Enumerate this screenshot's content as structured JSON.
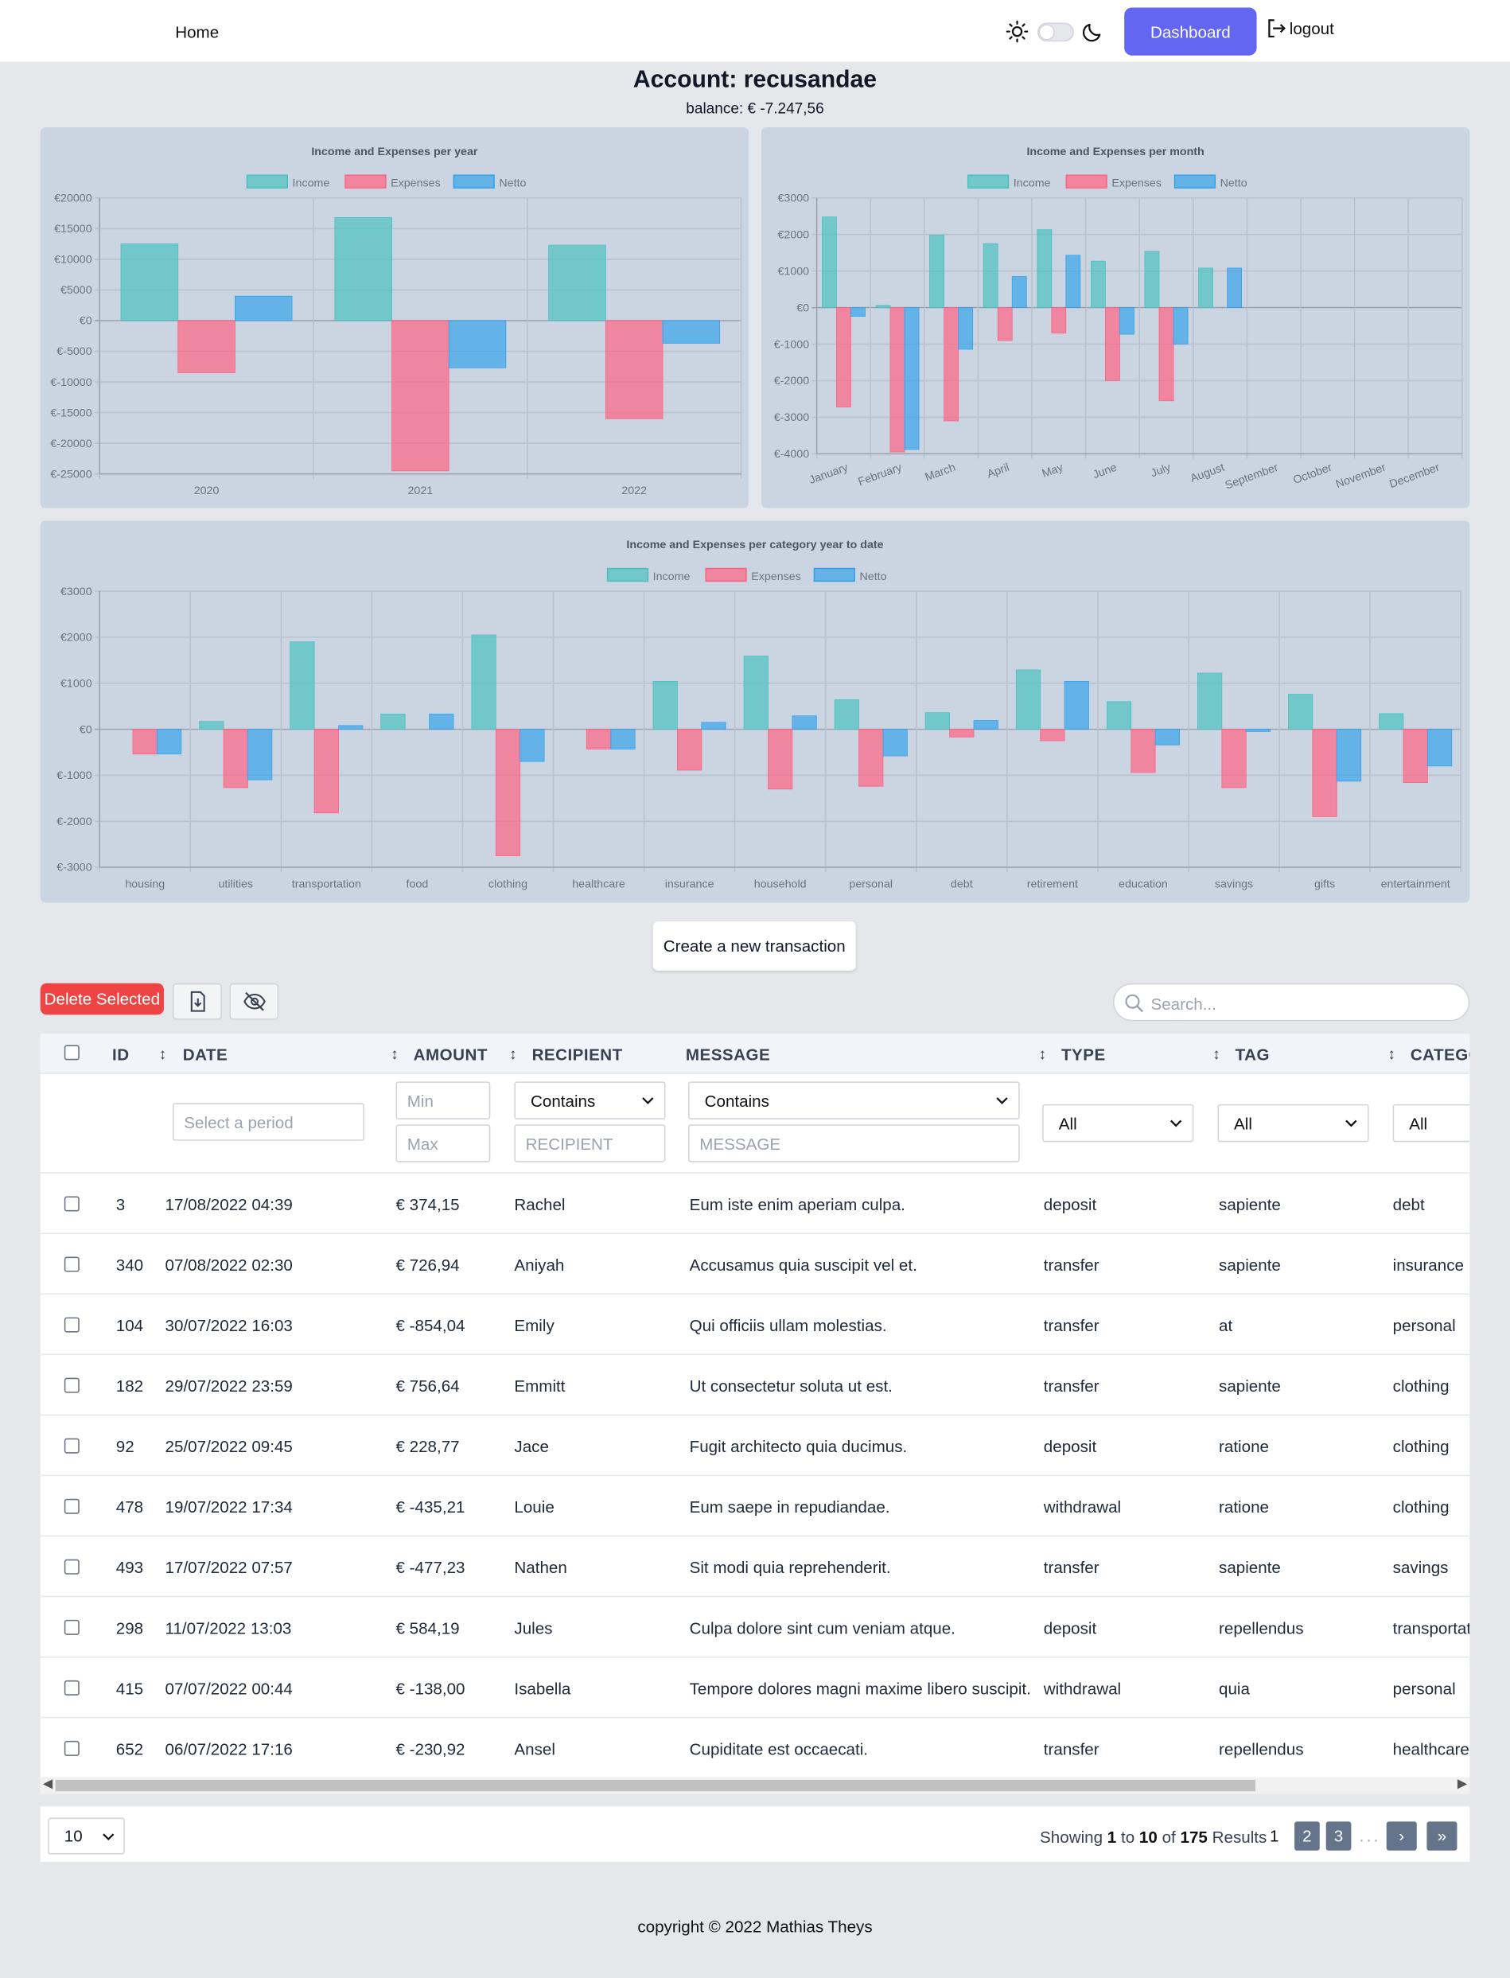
{
  "nav": {
    "home": "Home",
    "dashboard": "Dashboard",
    "logout": "logout"
  },
  "account": {
    "title": "Account: recusandae",
    "balance": "balance: € -7.247,56"
  },
  "colors": {
    "income": "#4bc0c0",
    "expenses": "#ff6384",
    "netto": "#36a2eb",
    "accent": "#6366f1",
    "delete": "#ef4444"
  },
  "legend": [
    "Income",
    "Expenses",
    "Netto"
  ],
  "chart_data": [
    {
      "type": "bar",
      "title": "Income and Expenses per year",
      "categories": [
        "2020",
        "2021",
        "2022"
      ],
      "series": [
        {
          "name": "Income",
          "values": [
            12500,
            16800,
            12300
          ]
        },
        {
          "name": "Expenses",
          "values": [
            -8500,
            -24500,
            -16000
          ]
        },
        {
          "name": "Netto",
          "values": [
            4000,
            -7700,
            -3700
          ]
        }
      ],
      "ylim": [
        -25000,
        20000
      ],
      "yticks": [
        "€20000",
        "€15000",
        "€10000",
        "€5000",
        "€0",
        "€-5000",
        "€-10000",
        "€-15000",
        "€-20000",
        "€-25000"
      ],
      "grid": true,
      "legend": "top"
    },
    {
      "type": "bar",
      "title": "Income and Expenses per month",
      "categories": [
        "January",
        "February",
        "March",
        "April",
        "May",
        "June",
        "July",
        "August",
        "September",
        "October",
        "November",
        "December"
      ],
      "series": [
        {
          "name": "Income",
          "values": [
            2480,
            60,
            1980,
            1750,
            2130,
            1270,
            1540,
            1080,
            0,
            0,
            0,
            0
          ]
        },
        {
          "name": "Expenses",
          "values": [
            -2720,
            -3950,
            -3100,
            -900,
            -700,
            -2000,
            -2550,
            0,
            0,
            0,
            0,
            0
          ]
        },
        {
          "name": "Netto",
          "values": [
            -240,
            -3880,
            -1140,
            850,
            1430,
            -730,
            -1000,
            1080,
            0,
            0,
            0,
            0
          ]
        }
      ],
      "ylim": [
        -4000,
        3000
      ],
      "yticks": [
        "€3000",
        "€2000",
        "€1000",
        "€0",
        "€-1000",
        "€-2000",
        "€-3000",
        "€-4000"
      ],
      "grid": true,
      "legend": "top"
    },
    {
      "type": "bar",
      "title": "Income and Expenses per category year to date",
      "categories": [
        "housing",
        "utilities",
        "transportation",
        "food",
        "clothing",
        "healthcare",
        "insurance",
        "household",
        "personal",
        "debt",
        "retirement",
        "education",
        "savings",
        "gifts",
        "entertainment"
      ],
      "series": [
        {
          "name": "Income",
          "values": [
            0,
            170,
            1900,
            330,
            2050,
            0,
            1040,
            1590,
            640,
            360,
            1290,
            600,
            1220,
            760,
            340
          ]
        },
        {
          "name": "Expenses",
          "values": [
            -540,
            -1270,
            -1820,
            0,
            -2750,
            -430,
            -890,
            -1300,
            -1240,
            -170,
            -250,
            -940,
            -1270,
            -1900,
            -1160
          ]
        },
        {
          "name": "Netto",
          "values": [
            -540,
            -1100,
            80,
            330,
            -700,
            -430,
            150,
            290,
            -580,
            190,
            1040,
            -340,
            -50,
            -1130,
            -800
          ]
        }
      ],
      "ylim": [
        -3000,
        3000
      ],
      "yticks": [
        "€3000",
        "€2000",
        "€1000",
        "€0",
        "€-1000",
        "€-2000",
        "€-3000"
      ],
      "grid": true,
      "legend": "top"
    }
  ],
  "toolbar": {
    "create": "Create a new transaction",
    "delete": "Delete Selected",
    "search_placeholder": "Search..."
  },
  "table": {
    "headers": {
      "id": "ID",
      "date": "DATE",
      "amount": "AMOUNT",
      "recipient": "RECIPIENT",
      "message": "MESSAGE",
      "type": "TYPE",
      "tag": "TAG",
      "category": "CATEGO"
    },
    "sort_glyph": "↕",
    "filters": {
      "period_placeholder": "Select a period",
      "min_placeholder": "Min",
      "max_placeholder": "Max",
      "recipient_mode": "Contains",
      "recipient_placeholder": "RECIPIENT",
      "message_mode": "Contains",
      "message_placeholder": "MESSAGE",
      "type": "All",
      "tag": "All",
      "category": "All"
    },
    "rows": [
      {
        "id": "3",
        "date": "17/08/2022 04:39",
        "amount": "€ 374,15",
        "recipient": "Rachel",
        "message": "Eum iste enim aperiam culpa.",
        "type": "deposit",
        "tag": "sapiente",
        "category": "debt"
      },
      {
        "id": "340",
        "date": "07/08/2022 02:30",
        "amount": "€ 726,94",
        "recipient": "Aniyah",
        "message": "Accusamus quia suscipit vel et.",
        "type": "transfer",
        "tag": "sapiente",
        "category": "insurance"
      },
      {
        "id": "104",
        "date": "30/07/2022 16:03",
        "amount": "€ -854,04",
        "recipient": "Emily",
        "message": "Qui officiis ullam molestias.",
        "type": "transfer",
        "tag": "at",
        "category": "personal"
      },
      {
        "id": "182",
        "date": "29/07/2022 23:59",
        "amount": "€ 756,64",
        "recipient": "Emmitt",
        "message": "Ut consectetur soluta ut est.",
        "type": "transfer",
        "tag": "sapiente",
        "category": "clothing"
      },
      {
        "id": "92",
        "date": "25/07/2022 09:45",
        "amount": "€ 228,77",
        "recipient": "Jace",
        "message": "Fugit architecto quia ducimus.",
        "type": "deposit",
        "tag": "ratione",
        "category": "clothing"
      },
      {
        "id": "478",
        "date": "19/07/2022 17:34",
        "amount": "€ -435,21",
        "recipient": "Louie",
        "message": "Eum saepe in repudiandae.",
        "type": "withdrawal",
        "tag": "ratione",
        "category": "clothing"
      },
      {
        "id": "493",
        "date": "17/07/2022 07:57",
        "amount": "€ -477,23",
        "recipient": "Nathen",
        "message": "Sit modi quia reprehenderit.",
        "type": "transfer",
        "tag": "sapiente",
        "category": "savings"
      },
      {
        "id": "298",
        "date": "11/07/2022 13:03",
        "amount": "€ 584,19",
        "recipient": "Jules",
        "message": "Culpa dolore sint cum veniam atque.",
        "type": "deposit",
        "tag": "repellendus",
        "category": "transportat"
      },
      {
        "id": "415",
        "date": "07/07/2022 00:44",
        "amount": "€ -138,00",
        "recipient": "Isabella",
        "message": "Tempore dolores magni maxime libero suscipit.",
        "type": "withdrawal",
        "tag": "quia",
        "category": "personal"
      },
      {
        "id": "652",
        "date": "06/07/2022 17:16",
        "amount": "€ -230,92",
        "recipient": "Ansel",
        "message": "Cupiditate est occaecati.",
        "type": "transfer",
        "tag": "repellendus",
        "category": "healthcare"
      }
    ]
  },
  "pagination": {
    "per_page": "10",
    "showing_prefix": "Showing",
    "from": "1",
    "to_word": "to",
    "to": "10",
    "of_word": "of",
    "total": "175",
    "results_word": "Results",
    "pages": [
      "1",
      "2",
      "3"
    ],
    "dots": "...",
    "next": "›",
    "last": "»"
  },
  "footer": {
    "copyright": "copyright © 2022 Mathias Theys"
  }
}
